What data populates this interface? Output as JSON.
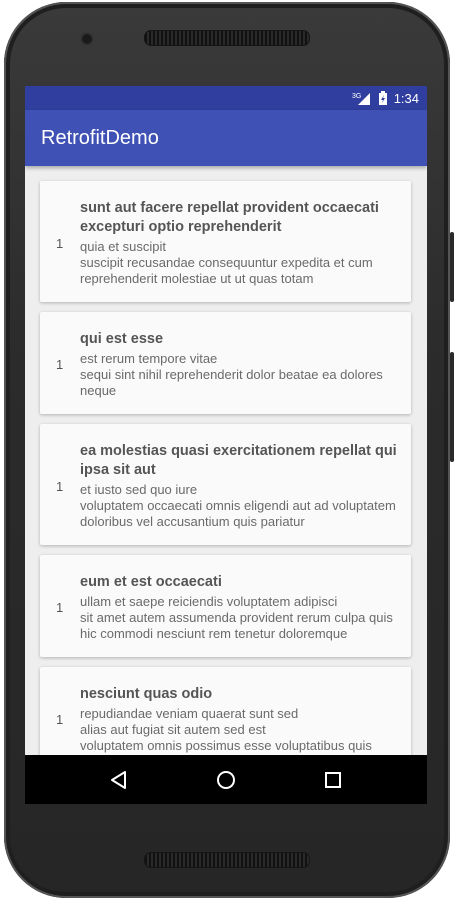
{
  "status_bar": {
    "network": "3G",
    "time": "1:34"
  },
  "app_bar": {
    "title": "RetrofitDemo"
  },
  "posts": [
    {
      "user_id": "1",
      "title": "sunt aut facere repellat provident occaecati excepturi optio reprehenderit",
      "body": "quia et suscipit\nsuscipit recusandae consequuntur expedita et cum reprehenderit molestiae ut ut quas totam"
    },
    {
      "user_id": "1",
      "title": "qui est esse",
      "body": "est rerum tempore vitae\nsequi sint nihil reprehenderit dolor beatae ea dolores neque"
    },
    {
      "user_id": "1",
      "title": "ea molestias quasi exercitationem repellat qui ipsa sit aut",
      "body": "et iusto sed quo iure\nvoluptatem occaecati omnis eligendi aut ad voluptatem doloribus vel accusantium quis pariatur"
    },
    {
      "user_id": "1",
      "title": "eum et est occaecati",
      "body": "ullam et saepe reiciendis voluptatem adipisci\nsit amet autem assumenda provident rerum culpa quis hic commodi nesciunt rem tenetur doloremque"
    },
    {
      "user_id": "1",
      "title": "nesciunt quas odio",
      "body": "repudiandae veniam quaerat sunt sed\nalias aut fugiat sit autem sed est\nvoluptatem omnis possimus esse voluptatibus quis"
    }
  ],
  "nav_bar": {
    "back_icon": "back-triangle-icon",
    "home_icon": "home-circle-icon",
    "recents_icon": "recents-square-icon"
  },
  "colors": {
    "primary": "#3f51b5",
    "primary_dark": "#303f9f",
    "card": "#fafafa",
    "background": "#eeeeee"
  }
}
